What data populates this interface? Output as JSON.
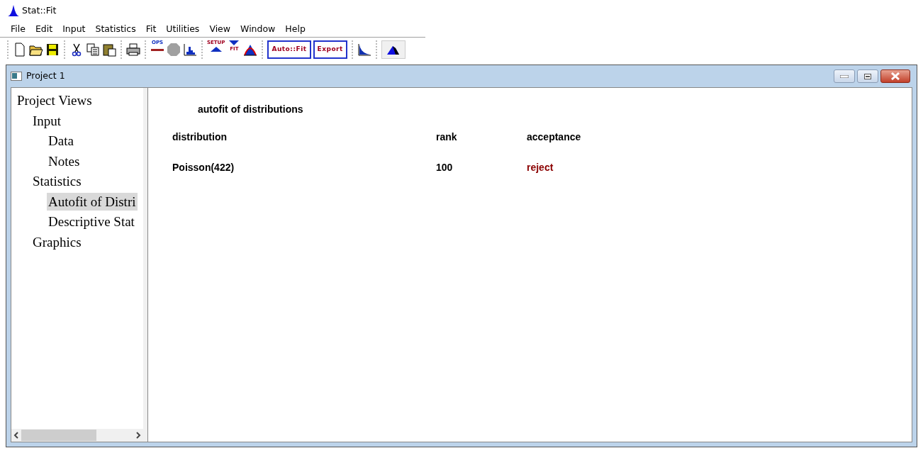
{
  "app": {
    "title": "Stat::Fit"
  },
  "menu": [
    "File",
    "Edit",
    "Input",
    "Statistics",
    "Fit",
    "Utilities",
    "View",
    "Window",
    "Help"
  ],
  "toolbar": [
    [
      {
        "kind": "new"
      },
      {
        "kind": "open"
      },
      {
        "kind": "save"
      }
    ],
    [
      {
        "kind": "cut"
      },
      {
        "kind": "copy"
      },
      {
        "kind": "paste"
      }
    ],
    [
      {
        "kind": "print"
      }
    ],
    [
      {
        "kind": "ops",
        "label": "OPS"
      },
      {
        "kind": "octagon",
        "disabled": true
      },
      {
        "kind": "histogram"
      }
    ],
    [
      {
        "kind": "setup",
        "label": "SETUP"
      },
      {
        "kind": "fit",
        "label": "FIT"
      },
      {
        "kind": "peak"
      }
    ],
    [
      {
        "kind": "textbutton",
        "label": "Auto::Fit"
      },
      {
        "kind": "textbutton",
        "label": "Export"
      }
    ],
    [
      {
        "kind": "decay"
      }
    ],
    [
      {
        "kind": "mountain",
        "pressed": true
      }
    ]
  ],
  "window": {
    "title": "Project 1"
  },
  "tree": [
    {
      "label": "Project Views",
      "selected": false,
      "children": [
        {
          "label": "Input",
          "selected": false,
          "children": [
            {
              "label": "Data",
              "selected": false
            },
            {
              "label": "Notes",
              "selected": false
            }
          ]
        },
        {
          "label": "Statistics",
          "selected": false,
          "children": [
            {
              "label": "Autofit of Distri",
              "selected": true
            },
            {
              "label": "Descriptive Stat",
              "selected": false
            }
          ]
        },
        {
          "label": "Graphics",
          "selected": false
        }
      ]
    }
  ],
  "report": {
    "title": "autofit of distributions",
    "columns": [
      {
        "header": "distribution",
        "kind": "text"
      },
      {
        "header": "rank",
        "kind": "text"
      },
      {
        "header": "acceptance",
        "kind": "verdict"
      }
    ],
    "rows": [
      [
        "Poisson(422)",
        "100",
        "reject"
      ]
    ]
  }
}
